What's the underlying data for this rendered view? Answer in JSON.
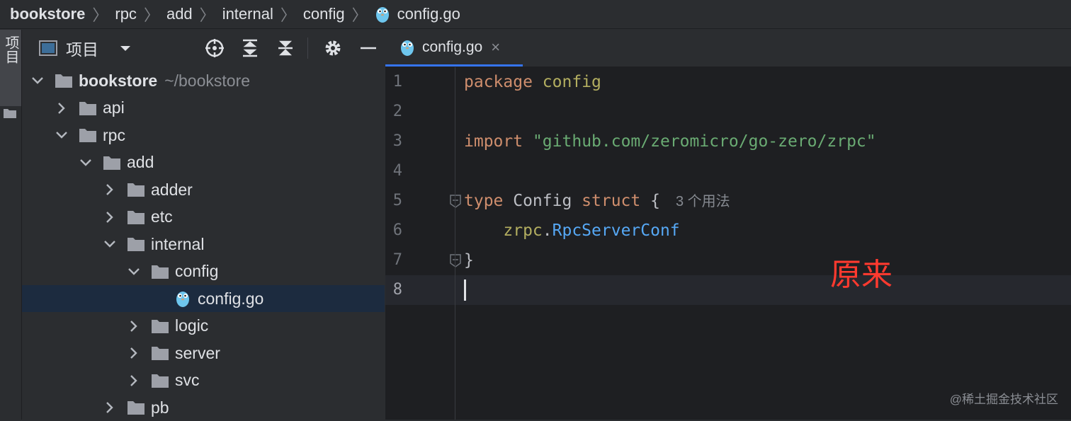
{
  "breadcrumb": [
    "bookstore",
    "rpc",
    "add",
    "internal",
    "config",
    "config.go"
  ],
  "tool_window_label": "项目",
  "project": {
    "title": "项目",
    "tree": [
      {
        "label": "bookstore",
        "hint": "~/bookstore",
        "level": 0,
        "expanded": true,
        "type": "folder",
        "bold": true
      },
      {
        "label": "api",
        "level": 1,
        "expanded": false,
        "type": "folder"
      },
      {
        "label": "rpc",
        "level": 1,
        "expanded": true,
        "type": "folder"
      },
      {
        "label": "add",
        "level": 2,
        "expanded": true,
        "type": "folder"
      },
      {
        "label": "adder",
        "level": 3,
        "expanded": false,
        "type": "folder"
      },
      {
        "label": "etc",
        "level": 3,
        "expanded": false,
        "type": "folder"
      },
      {
        "label": "internal",
        "level": 3,
        "expanded": true,
        "type": "folder"
      },
      {
        "label": "config",
        "level": 4,
        "expanded": true,
        "type": "folder"
      },
      {
        "label": "config.go",
        "level": 5,
        "type": "go-file",
        "selected": true
      },
      {
        "label": "logic",
        "level": 4,
        "expanded": false,
        "type": "folder"
      },
      {
        "label": "server",
        "level": 4,
        "expanded": false,
        "type": "folder"
      },
      {
        "label": "svc",
        "level": 4,
        "expanded": false,
        "type": "folder"
      },
      {
        "label": "pb",
        "level": 3,
        "expanded": false,
        "type": "folder"
      }
    ]
  },
  "editor": {
    "tab": {
      "label": "config.go",
      "close": "×"
    },
    "lines": [
      {
        "n": "1",
        "tokens": [
          [
            "kw",
            "package"
          ],
          [
            "id",
            " "
          ],
          [
            "pkg",
            "config"
          ]
        ]
      },
      {
        "n": "2",
        "tokens": []
      },
      {
        "n": "3",
        "tokens": [
          [
            "kw",
            "import"
          ],
          [
            "id",
            " "
          ],
          [
            "str",
            "\"github.com/zeromicro/go-zero/zrpc\""
          ]
        ]
      },
      {
        "n": "4",
        "tokens": []
      },
      {
        "n": "5",
        "tokens": [
          [
            "kw",
            "type"
          ],
          [
            "id",
            " Config "
          ],
          [
            "kw",
            "struct"
          ],
          [
            "id",
            " {"
          ]
        ],
        "inlay": "3 个用法",
        "fold": true
      },
      {
        "n": "6",
        "tokens": [
          [
            "id",
            "    "
          ],
          [
            "pkg",
            "zrpc"
          ],
          [
            "id",
            "."
          ],
          [
            "typ",
            "RpcServerConf"
          ]
        ]
      },
      {
        "n": "7",
        "tokens": [
          [
            "id",
            "}"
          ]
        ],
        "fold": true
      },
      {
        "n": "8",
        "tokens": [],
        "current": true
      }
    ]
  },
  "annotation": "原来",
  "watermark": "@稀土掘金技术社区",
  "colors": {
    "accent": "#3574f0",
    "annotation": "#ff3a2f",
    "keyword": "#cf8e6d",
    "string": "#6aab73"
  }
}
